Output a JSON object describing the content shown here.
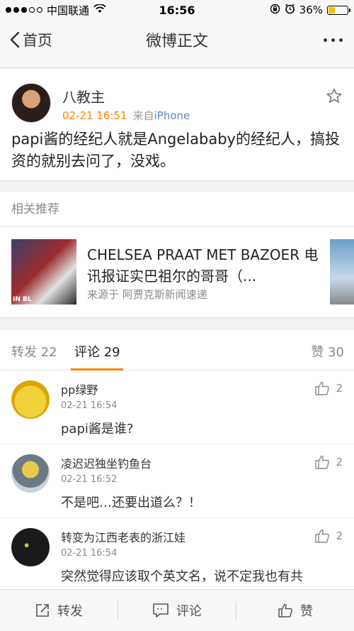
{
  "status_bar": {
    "carrier": "中国联通",
    "time": "16:56",
    "battery_percent": "36%",
    "battery_level": 0.36,
    "signal_dots_filled": 3,
    "signal_dots_total": 5
  },
  "nav": {
    "back_label": "首页",
    "title": "微博正文"
  },
  "post": {
    "author": "八教主",
    "time": "02-21 16:51",
    "from_prefix": "来自",
    "source": "iPhone",
    "text": "papi酱的经纪人就是Angelababy的经纪人，搞投资的就别去问了，没戏。"
  },
  "related": {
    "header": "相关推荐",
    "item": {
      "title": "CHELSEA PRAAT MET BAZOER  电讯报证实巴祖尔的哥哥（...",
      "thumb_tag": "IN BL",
      "source": "来源于 阿贾克斯新闻速递"
    }
  },
  "tabs": {
    "repost": "转发 22",
    "comment": "评论 29",
    "like": "赞 30"
  },
  "comments": [
    {
      "name": "pp绿野",
      "time": "02-21 16:54",
      "text": "papi酱是谁?",
      "likes": "2"
    },
    {
      "name": "凌迟迟独坐钓鱼台",
      "time": "02-21 16:52",
      "text": "不是吧…还要出道么？！",
      "likes": "2"
    },
    {
      "name": "转变为江西老表的浙江娃",
      "time": "02-21 16:54",
      "text": "突然觉得应该取个英文名，说不定我也有共",
      "likes": "2"
    }
  ],
  "toolbar": {
    "repost": "转发",
    "comment": "评论",
    "like": "赞"
  },
  "colors": {
    "accent": "#ff8200",
    "link": "#5b84c2"
  }
}
